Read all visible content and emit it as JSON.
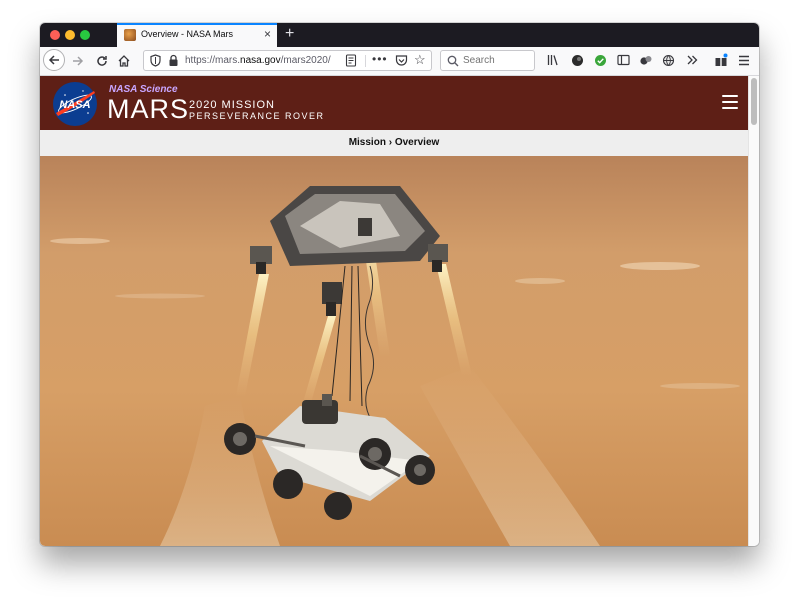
{
  "browser": {
    "tab": {
      "title": "Overview - NASA Mars",
      "close": "×"
    },
    "new_tab": "+",
    "url": {
      "prefix": "https://mars.",
      "domain": "nasa.gov",
      "path": "/mars2020/"
    },
    "search_placeholder": "Search",
    "more": "•••"
  },
  "site": {
    "nasa_science": "NASA Science",
    "mars": "MARS",
    "mission_line1": "2020 MISSION",
    "mission_line2": "PERSEVERANCE ROVER",
    "logo_text": "NASA",
    "breadcrumb": "Mission › Overview"
  },
  "hero": {
    "description": "Artist concept of the sky crane lowering the Perseverance rover onto Mars"
  },
  "colors": {
    "header_bg": "#5e1f16",
    "accent": "#0a84ff",
    "sky": "#c98c52"
  }
}
